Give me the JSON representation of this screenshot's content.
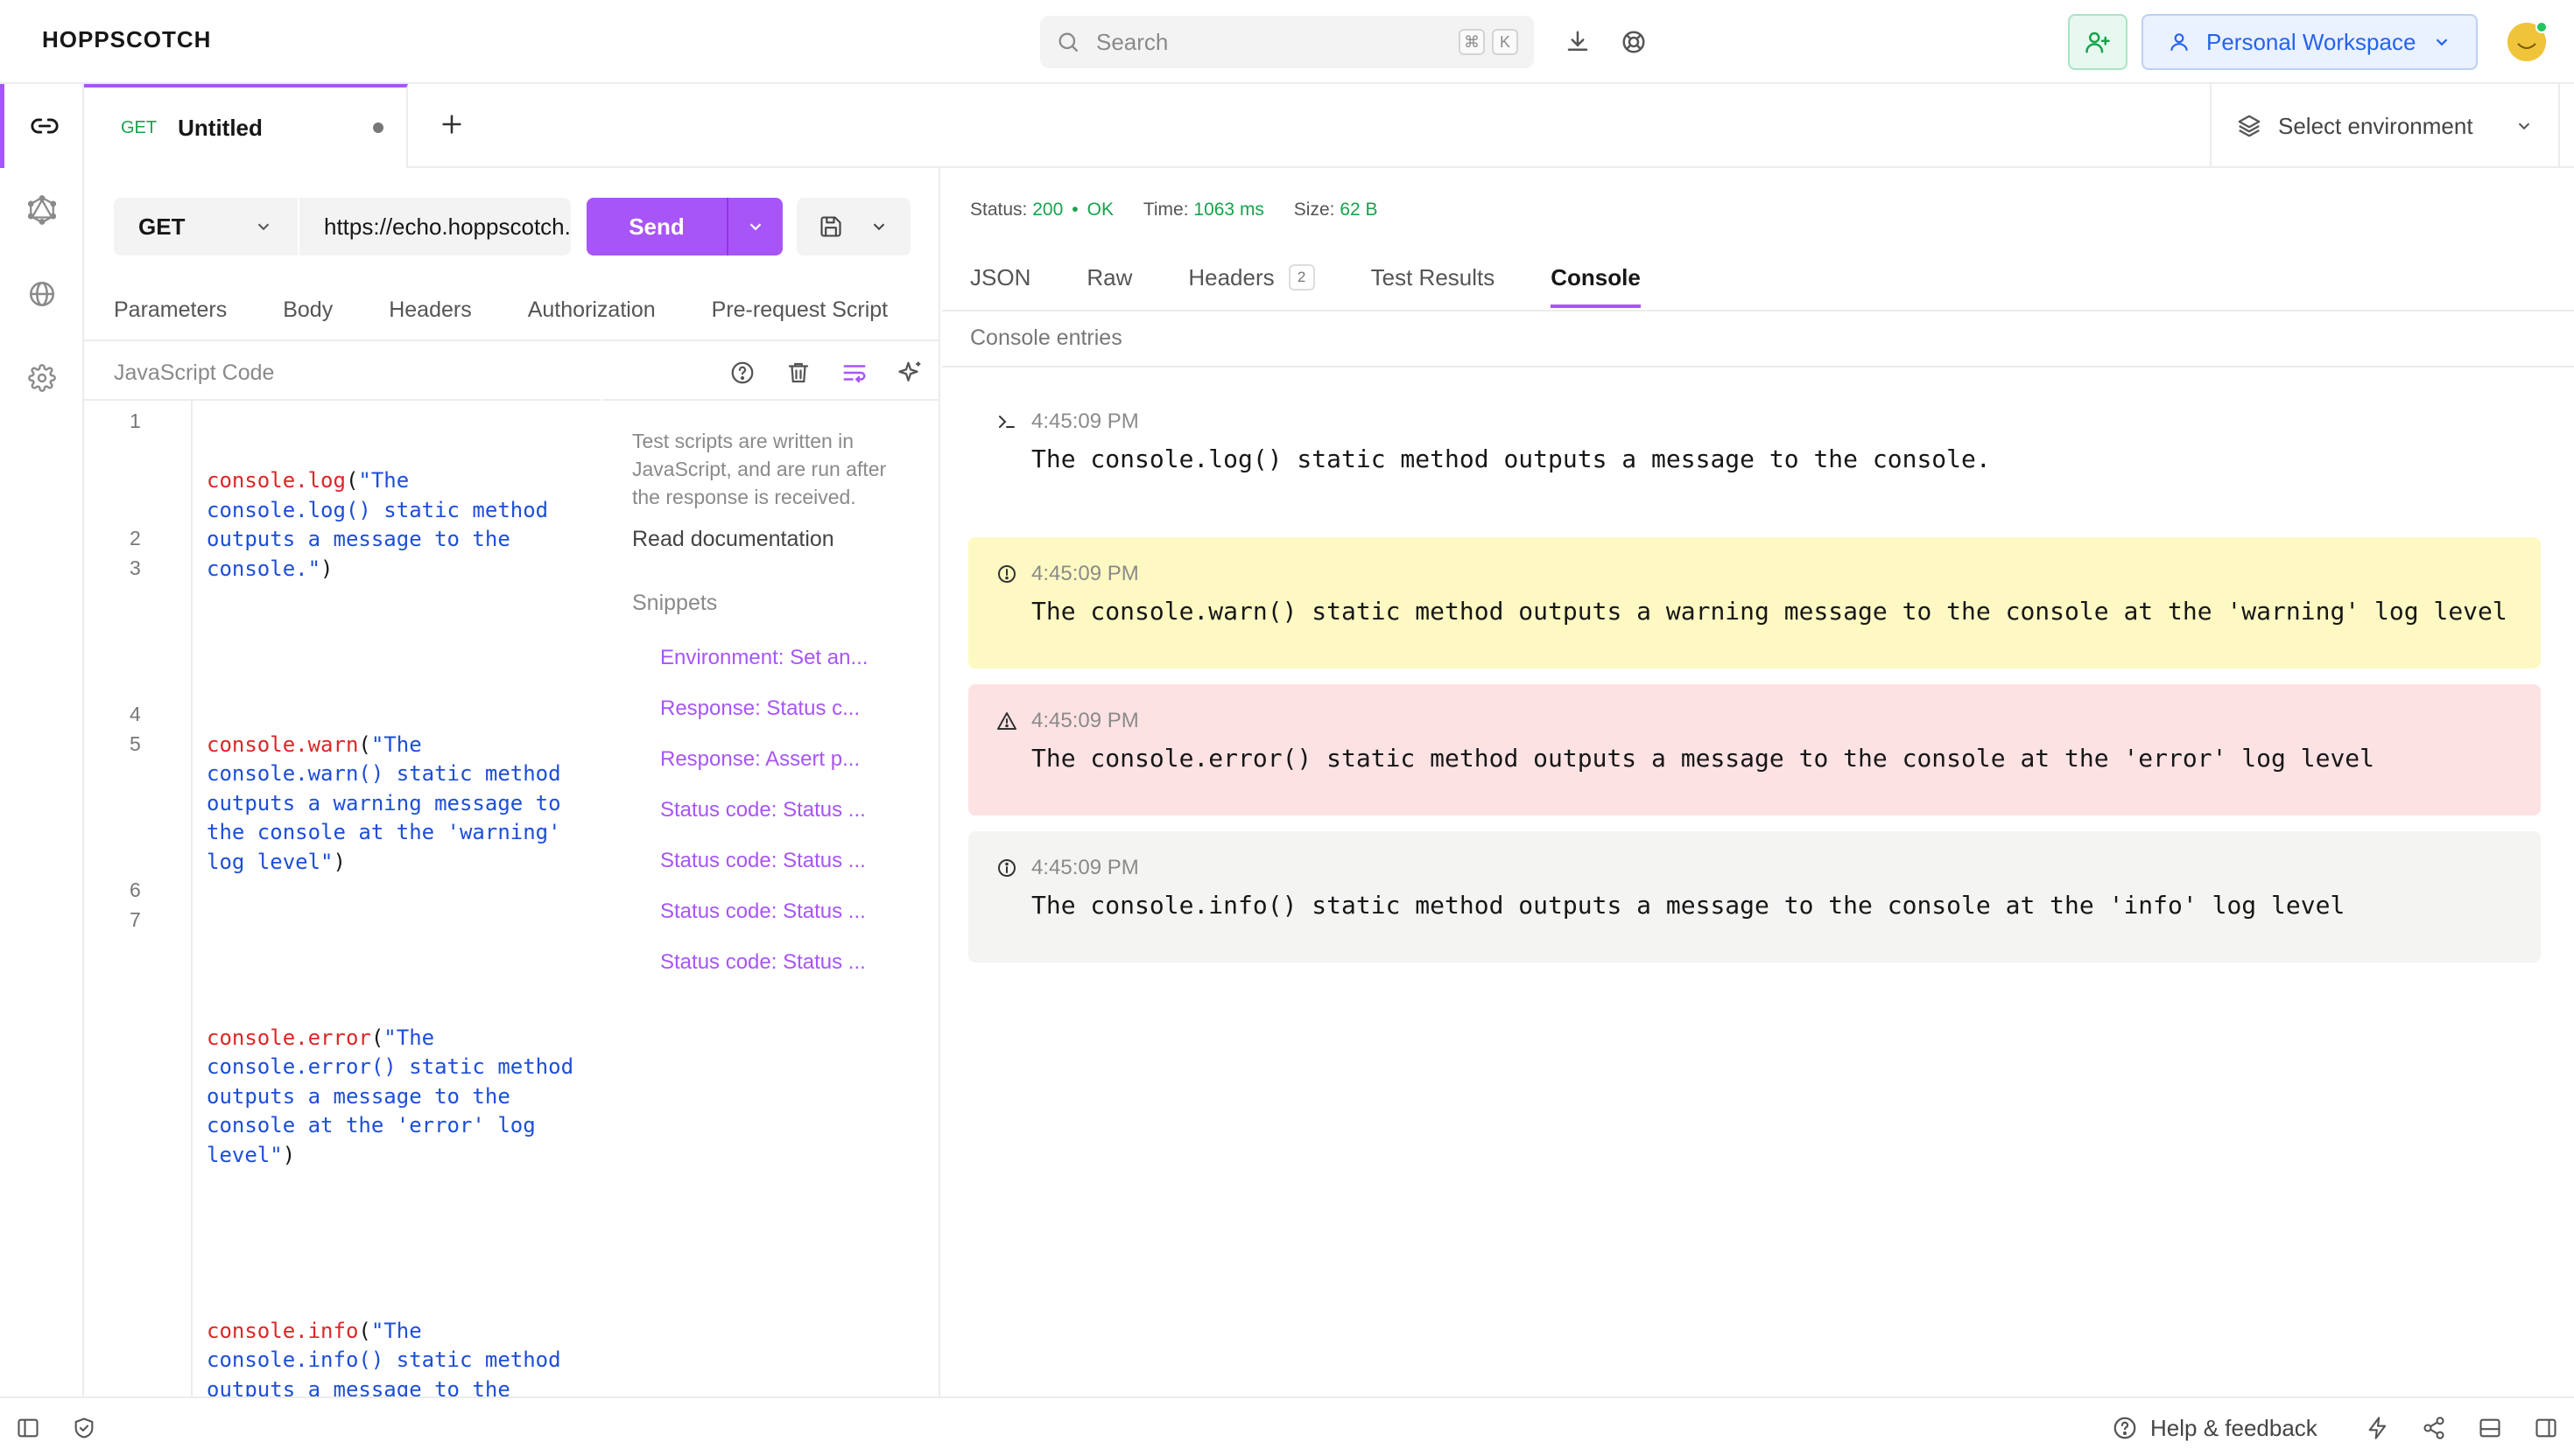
{
  "app": {
    "brand": "HOPPSCOTCH"
  },
  "header": {
    "search_placeholder": "Search",
    "search_kbd": [
      "⌘",
      "K"
    ],
    "workspace_label": "Personal Workspace"
  },
  "tabs": [
    {
      "method": "GET",
      "title": "Untitled",
      "dirty": true
    }
  ],
  "environment": {
    "label": "Select environment"
  },
  "request": {
    "method": "GET",
    "url": "https://echo.hoppscotch.io",
    "send_label": "Send",
    "tabs": [
      "Parameters",
      "Body",
      "Headers",
      "Authorization",
      "Pre-request Script"
    ],
    "editor_label": "JavaScript Code",
    "code_lines": [
      {
        "n": "1",
        "fn": "console.log",
        "str": "\"The console.log() static method outputs a message to the console.\""
      },
      {
        "n": "2"
      },
      {
        "n": "3",
        "fn": "console.warn",
        "str": "\"The console.warn() static method outputs a warning message to the console at the 'warning' log level\""
      },
      {
        "n": "4"
      },
      {
        "n": "5",
        "fn": "console.error",
        "str": "\"The console.error() static method outputs a message to the console at the 'error' log level\""
      },
      {
        "n": "6"
      },
      {
        "n": "7",
        "fn": "console.info",
        "str": "\"The console.info() static method outputs a message to the console at the 'info' log level\""
      }
    ],
    "help_text": "Test scripts are written in JavaScript, and are run after the response is received.",
    "read_docs": "Read documentation",
    "snippets_heading": "Snippets",
    "snippets": [
      "Environment: Set an...",
      "Response: Status c...",
      "Response: Assert p...",
      "Status code: Status ...",
      "Status code: Status ...",
      "Status code: Status ...",
      "Status code: Status ..."
    ]
  },
  "response": {
    "status_label": "Status:",
    "status_code": "200",
    "status_text": "OK",
    "time_label": "Time:",
    "time_value": "1063 ms",
    "size_label": "Size:",
    "size_value": "62 B",
    "tabs": [
      {
        "label": "JSON"
      },
      {
        "label": "Raw"
      },
      {
        "label": "Headers",
        "badge": "2"
      },
      {
        "label": "Test Results"
      },
      {
        "label": "Console",
        "active": true
      }
    ],
    "entries_heading": "Console entries",
    "entries": [
      {
        "level": "log",
        "time": "4:45:09 PM",
        "message": "The console.log() static method outputs a message to the console."
      },
      {
        "level": "warn",
        "time": "4:45:09 PM",
        "message": "The console.warn() static method outputs a warning message to the console at the 'warning' log level"
      },
      {
        "level": "error",
        "time": "4:45:09 PM",
        "message": "The console.error() static method outputs a message to the console at the 'error' log level"
      },
      {
        "level": "info",
        "time": "4:45:09 PM",
        "message": "The console.info() static method outputs a message to the console at the 'info' log level"
      }
    ]
  },
  "footer": {
    "help_label": "Help & feedback"
  },
  "colors": {
    "accent": "#a855f7",
    "success": "#16a34a",
    "warn_bg": "#fef9c3",
    "error_bg": "#fde2e4",
    "info_bg": "#f4f4f3",
    "workspace": "#2563eb"
  }
}
